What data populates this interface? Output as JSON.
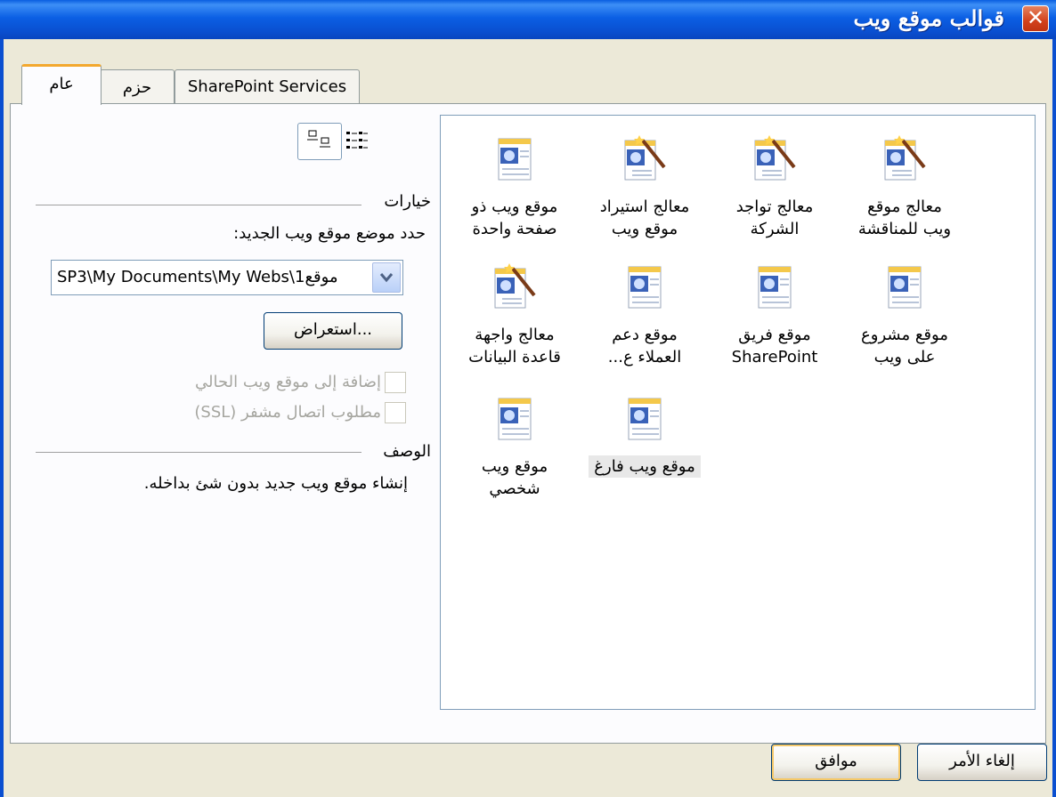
{
  "window": {
    "title": "قوالب موقع ويب",
    "close_symbol": "✕"
  },
  "tabs": [
    {
      "label": "عام",
      "active": true
    },
    {
      "label": "حزم",
      "active": false
    },
    {
      "label": "SharePoint Services",
      "active": false
    }
  ],
  "templates": [
    {
      "label_line1": "معالج موقع",
      "label_line2": "ويب للمناقشة",
      "icon": "wizard-icon"
    },
    {
      "label_line1": "معالج تواجد",
      "label_line2": "الشركة",
      "icon": "wizard-icon"
    },
    {
      "label_line1": "معالج استيراد",
      "label_line2": "موقع ويب",
      "icon": "wizard-icon"
    },
    {
      "label_line1": "موقع ويب ذو",
      "label_line2": "صفحة واحدة",
      "icon": "web-page-icon"
    },
    {
      "label_line1": "موقع مشروع",
      "label_line2": "على ويب",
      "icon": "web-page-icon"
    },
    {
      "label_line1": "موقع فريق",
      "label_line2": "SharePoint",
      "icon": "web-page-icon"
    },
    {
      "label_line1": "موقع دعم",
      "label_line2": "العملاء ع...",
      "icon": "web-page-icon"
    },
    {
      "label_line1": "معالج واجهة",
      "label_line2": "قاعدة البيانات",
      "icon": "wizard-icon"
    },
    {
      "label_line1": "موقع ويب فارغ",
      "label_line2": "",
      "icon": "web-page-icon",
      "selected": true
    },
    {
      "label_line1": "موقع ويب",
      "label_line2": "شخصي",
      "icon": "web-page-icon"
    }
  ],
  "options": {
    "heading": "خيارات",
    "location_label": "حدد موضع موقع ويب الجديد:",
    "location_value": "SP3\\My Documents\\My Webs\\موقع1",
    "browse_label": "استعراض...",
    "add_to_current_label": "إضافة إلى موقع ويب الحالي",
    "ssl_label": "مطلوب اتصال مشفر (SSL)"
  },
  "description": {
    "heading": "الوصف",
    "text": "إنشاء موقع ويب جديد بدون شئ بداخله."
  },
  "buttons": {
    "ok": "موافق",
    "cancel": "إلغاء الأمر"
  },
  "colors": {
    "title_bar": "#0a5ee0",
    "dialog_bg": "#ece9d8",
    "active_tab_accent": "#f3a82e"
  }
}
